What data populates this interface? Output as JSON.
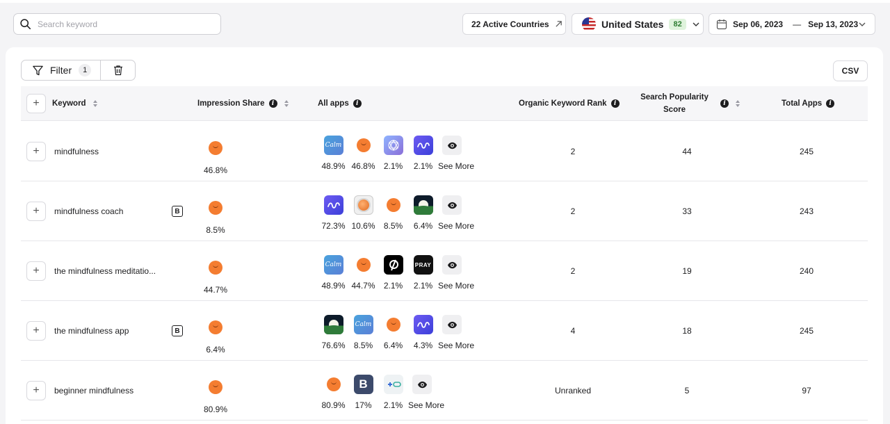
{
  "search": {
    "placeholder": "Search keyword",
    "value": ""
  },
  "header": {
    "countries_label": "22 Active Countries",
    "country": "United States",
    "country_count": "82",
    "date_from": "Sep 06, 2023",
    "date_sep": "—",
    "date_to": "Sep 13, 2023"
  },
  "toolbar": {
    "filter_label": "Filter",
    "filter_count": "1",
    "csv_label": "CSV"
  },
  "columns": {
    "keyword": "Keyword",
    "impression_share": "Impression Share",
    "all_apps": "All apps",
    "organic_rank": "Organic Keyword Rank",
    "search_popularity": "Search Popularity Score",
    "total_apps": "Total Apps"
  },
  "see_more": "See More",
  "rows": [
    {
      "keyword": "mindfulness",
      "badge": "",
      "impression": "46.8%",
      "apps": [
        {
          "icon": "calm-icon",
          "pct": "48.9%"
        },
        {
          "icon": "headspace-icon",
          "pct": "46.8%"
        },
        {
          "icon": "aura-icon",
          "pct": "2.1%"
        },
        {
          "icon": "mindfulness-app-icon",
          "pct": "2.1%"
        }
      ],
      "rank": "2",
      "score": "44",
      "total": "245"
    },
    {
      "keyword": "mindfulness coach",
      "badge": "B",
      "impression": "8.5%",
      "apps": [
        {
          "icon": "mindfulness-app-icon",
          "pct": "72.3%"
        },
        {
          "icon": "orb-icon",
          "pct": "10.6%"
        },
        {
          "icon": "headspace-icon",
          "pct": "8.5%"
        },
        {
          "icon": "nature-icon",
          "pct": "6.4%"
        }
      ],
      "rank": "2",
      "score": "33",
      "total": "243"
    },
    {
      "keyword": "the mindfulness meditatio...",
      "badge": "",
      "impression": "44.7%",
      "apps": [
        {
          "icon": "calm-icon",
          "pct": "48.9%"
        },
        {
          "icon": "headspace-icon",
          "pct": "44.7%"
        },
        {
          "icon": "peloton-icon",
          "pct": "2.1%"
        },
        {
          "icon": "pray-icon",
          "pct": "2.1%"
        }
      ],
      "rank": "2",
      "score": "19",
      "total": "240"
    },
    {
      "keyword": "the mindfulness app",
      "badge": "B",
      "impression": "6.4%",
      "apps": [
        {
          "icon": "nature-icon",
          "pct": "76.6%"
        },
        {
          "icon": "calm-icon",
          "pct": "8.5%"
        },
        {
          "icon": "headspace-icon",
          "pct": "6.4%"
        },
        {
          "icon": "mindfulness-app-icon",
          "pct": "4.3%"
        }
      ],
      "rank": "4",
      "score": "18",
      "total": "245"
    },
    {
      "keyword": "beginner mindfulness",
      "badge": "",
      "impression": "80.9%",
      "apps": [
        {
          "icon": "headspace-icon",
          "pct": "80.9%"
        },
        {
          "icon": "b-app-icon",
          "pct": "17%"
        },
        {
          "icon": "pill-app-icon",
          "pct": "2.1%"
        }
      ],
      "rank": "Unranked",
      "score": "5",
      "total": "97"
    }
  ],
  "pray_text": "PRAY",
  "b_app_text": "B",
  "calm_text": "Calm",
  "colors": {
    "headspace": "#f47d31",
    "badge_green_bg": "#dff3dc",
    "badge_green_fg": "#2e7d32"
  }
}
